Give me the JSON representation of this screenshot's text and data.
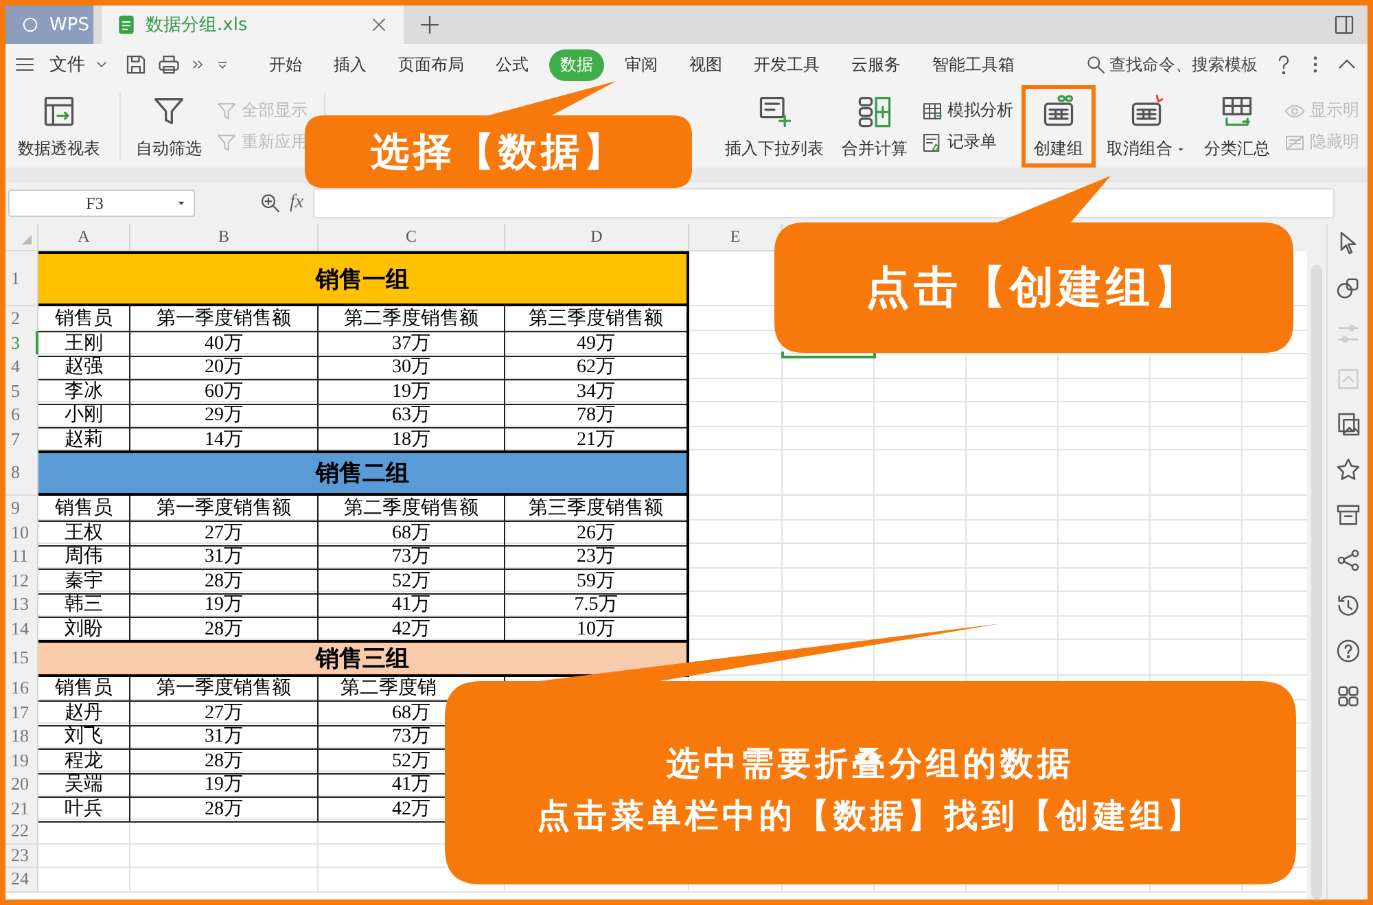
{
  "tabs": [
    {
      "kind": "home",
      "label": "WPS",
      "selected": false
    },
    {
      "kind": "document",
      "label": "数据分组.xls",
      "selected": true
    }
  ],
  "menu": {
    "file": "文件",
    "tabs": [
      {
        "label": "开始",
        "selected": false
      },
      {
        "label": "插入",
        "selected": false
      },
      {
        "label": "页面布局",
        "selected": false
      },
      {
        "label": "公式",
        "selected": false
      },
      {
        "label": "数据",
        "selected": true
      },
      {
        "label": "审阅",
        "selected": false
      },
      {
        "label": "视图",
        "selected": false
      },
      {
        "label": "开发工具",
        "selected": false
      },
      {
        "label": "云服务",
        "selected": false
      },
      {
        "label": "智能工具箱",
        "selected": false
      }
    ],
    "search": {
      "placeholder": "查找命令、搜索模板"
    }
  },
  "ribbon": {
    "items": [
      {
        "kind": "large",
        "label": "数据透视表",
        "dropdown": false
      },
      {
        "kind": "large",
        "label": "自动筛选",
        "dropdown": false
      },
      {
        "kind": "stacked",
        "entries": [
          {
            "label": "全部显示",
            "disabled": true
          },
          {
            "label": "重新应用",
            "disabled": true
          }
        ]
      },
      {
        "kind": "large",
        "label": "插入下拉列表",
        "dropdown": false
      },
      {
        "kind": "large",
        "label": "合并计算",
        "dropdown": false
      },
      {
        "kind": "stacked",
        "entries": [
          {
            "label": "模拟分析",
            "disabled": false
          },
          {
            "label": "记录单",
            "disabled": false
          }
        ]
      },
      {
        "kind": "large",
        "label": "创建组",
        "dropdown": false
      },
      {
        "kind": "large",
        "label": "取消组合",
        "dropdown": true
      },
      {
        "kind": "large",
        "label": "分类汇总",
        "dropdown": false
      },
      {
        "kind": "stacked",
        "entries": [
          {
            "label": "显示明",
            "disabled": true
          },
          {
            "label": "隐藏明",
            "disabled": true
          }
        ]
      }
    ]
  },
  "formula_bar": {
    "name_box": "F3",
    "function_label": "fx"
  },
  "sheet": {
    "columns": [
      "A",
      "B",
      "C",
      "D",
      "E"
    ],
    "rows": [
      {
        "number": "1",
        "kind": "group",
        "title": "销售一组",
        "color": "#ffc000",
        "selected": false
      },
      {
        "number": "2",
        "kind": "header",
        "cells": [
          "销售员",
          "第一季度销售额",
          "第二季度销售额",
          "第三季度销售额"
        ],
        "selected": false
      },
      {
        "number": "3",
        "kind": "data",
        "cells": [
          "王刚",
          "40万",
          "37万",
          "49万"
        ],
        "selected": true
      },
      {
        "number": "4",
        "kind": "data",
        "cells": [
          "赵强",
          "20万",
          "30万",
          "62万"
        ],
        "selected": false
      },
      {
        "number": "5",
        "kind": "data",
        "cells": [
          "李冰",
          "60万",
          "19万",
          "34万"
        ],
        "selected": false
      },
      {
        "number": "6",
        "kind": "data",
        "cells": [
          "小刚",
          "29万",
          "63万",
          "78万"
        ],
        "selected": false
      },
      {
        "number": "7",
        "kind": "data",
        "cells": [
          "赵莉",
          "14万",
          "18万",
          "21万"
        ],
        "selected": false
      },
      {
        "number": "8",
        "kind": "group",
        "title": "销售二组",
        "color": "#5b9bd5",
        "selected": false
      },
      {
        "number": "9",
        "kind": "header",
        "cells": [
          "销售员",
          "第一季度销售额",
          "第二季度销售额",
          "第三季度销售额"
        ],
        "selected": false
      },
      {
        "number": "10",
        "kind": "data",
        "cells": [
          "王权",
          "27万",
          "68万",
          "26万"
        ],
        "selected": false
      },
      {
        "number": "11",
        "kind": "data",
        "cells": [
          "周伟",
          "31万",
          "73万",
          "23万"
        ],
        "selected": false
      },
      {
        "number": "12",
        "kind": "data",
        "cells": [
          "秦宇",
          "28万",
          "52万",
          "59万"
        ],
        "selected": false
      },
      {
        "number": "13",
        "kind": "data",
        "cells": [
          "韩三",
          "19万",
          "41万",
          "7.5万"
        ],
        "selected": false
      },
      {
        "number": "14",
        "kind": "data",
        "cells": [
          "刘盼",
          "28万",
          "42万",
          "10万"
        ],
        "selected": false
      },
      {
        "number": "15",
        "kind": "group",
        "title": "销售三组",
        "color": "#f8cbad",
        "selected": false
      },
      {
        "number": "16",
        "kind": "header",
        "cells": [
          "销售员",
          "第一季度销售额",
          "第二季度销"
        ],
        "selected": false
      },
      {
        "number": "17",
        "kind": "data",
        "cells": [
          "赵丹",
          "27万",
          "68万"
        ],
        "selected": false
      },
      {
        "number": "18",
        "kind": "data",
        "cells": [
          "刘飞",
          "31万",
          "73万"
        ],
        "selected": false
      },
      {
        "number": "19",
        "kind": "data",
        "cells": [
          "程龙",
          "28万",
          "52万"
        ],
        "selected": false
      },
      {
        "number": "20",
        "kind": "data",
        "cells": [
          "吴端",
          "19万",
          "41万"
        ],
        "selected": false
      },
      {
        "number": "21",
        "kind": "data",
        "cells": [
          "叶兵",
          "28万",
          "42万"
        ],
        "selected": false
      },
      {
        "number": "22",
        "kind": "empty",
        "selected": false
      },
      {
        "number": "23",
        "kind": "empty",
        "selected": false
      },
      {
        "number": "24",
        "kind": "empty",
        "selected": false
      }
    ]
  },
  "sidebar": {
    "tools": [
      {
        "disabled": false
      },
      {
        "disabled": false
      },
      {
        "disabled": true
      },
      {
        "disabled": true
      },
      {
        "disabled": false
      },
      {
        "disabled": false
      },
      {
        "disabled": false
      },
      {
        "disabled": false
      },
      {
        "disabled": false
      },
      {
        "disabled": false
      },
      {
        "disabled": false
      }
    ]
  },
  "callouts": [
    {
      "lines": [
        "选择【数据】"
      ]
    },
    {
      "lines": [
        "点击【创建组】"
      ]
    },
    {
      "lines": [
        "选中需要折叠分组的数据",
        "点击菜单栏中的【数据】找到【创建组】"
      ]
    }
  ]
}
